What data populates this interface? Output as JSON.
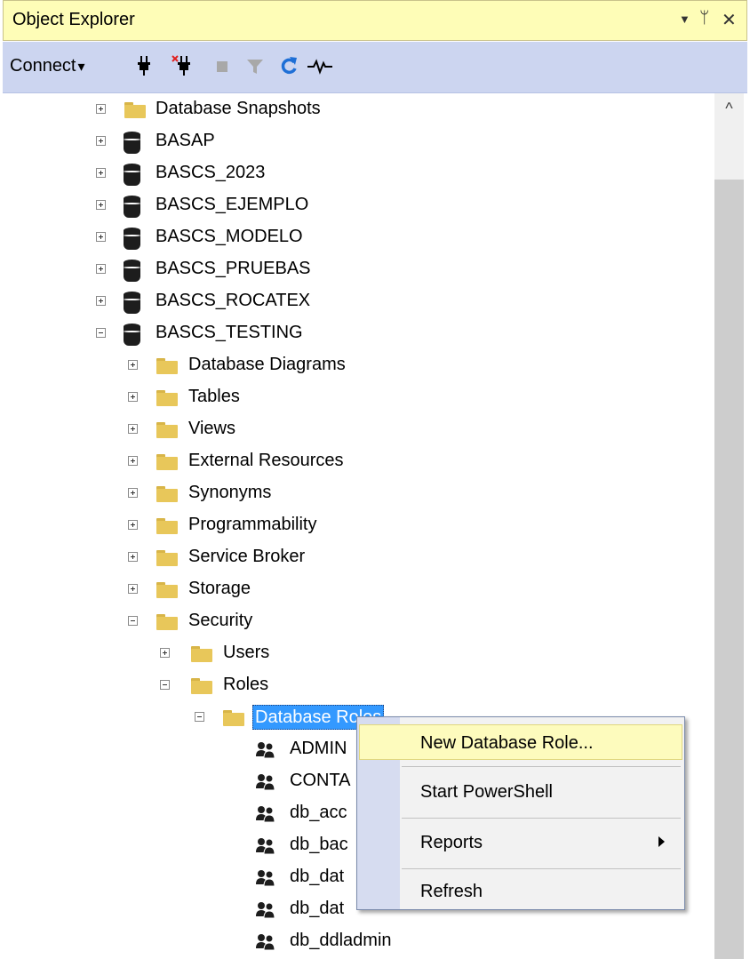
{
  "window": {
    "title": "Object Explorer",
    "controls": {
      "dropdown": "▼",
      "pin": "ᛘ",
      "close": "✕"
    }
  },
  "toolbar": {
    "connect_label": "Connect",
    "connect_caret": "▾",
    "tools": [
      "connect-plug-icon",
      "disconnect-plug-icon",
      "stop-icon",
      "filter-icon",
      "refresh-icon",
      "activity-monitor-icon"
    ]
  },
  "tree": {
    "items": [
      {
        "label": "Database Snapshots"
      },
      {
        "label": "BASAP"
      },
      {
        "label": "BASCS_2023"
      },
      {
        "label": "BASCS_EJEMPLO"
      },
      {
        "label": "BASCS_MODELO"
      },
      {
        "label": "BASCS_PRUEBAS"
      },
      {
        "label": "BASCS_ROCATEX"
      },
      {
        "label": "BASCS_TESTING"
      },
      {
        "label": "Database Diagrams"
      },
      {
        "label": "Tables"
      },
      {
        "label": "Views"
      },
      {
        "label": "External Resources"
      },
      {
        "label": "Synonyms"
      },
      {
        "label": "Programmability"
      },
      {
        "label": "Service Broker"
      },
      {
        "label": "Storage"
      },
      {
        "label": "Security"
      },
      {
        "label": "Users"
      },
      {
        "label": "Roles"
      },
      {
        "label": "Database Roles"
      },
      {
        "label": "ADMIN"
      },
      {
        "label": "CONTA"
      },
      {
        "label": "db_acc"
      },
      {
        "label": "db_bac"
      },
      {
        "label": "db_dat"
      },
      {
        "label": "db_dat"
      },
      {
        "label": "db_ddladmin"
      }
    ]
  },
  "context_menu": {
    "items": [
      {
        "label": "New Database Role..."
      },
      {
        "label": "Start PowerShell"
      },
      {
        "label": "Reports"
      },
      {
        "label": "Refresh"
      }
    ]
  },
  "scrollbar": {
    "up_arrow": "^"
  },
  "colors": {
    "title_bar": "#fefdb7",
    "toolbar": "#ccd5f0",
    "selection": "#3399ff",
    "menu_highlight": "#fdfbbd",
    "folder": "#e8c75a"
  }
}
